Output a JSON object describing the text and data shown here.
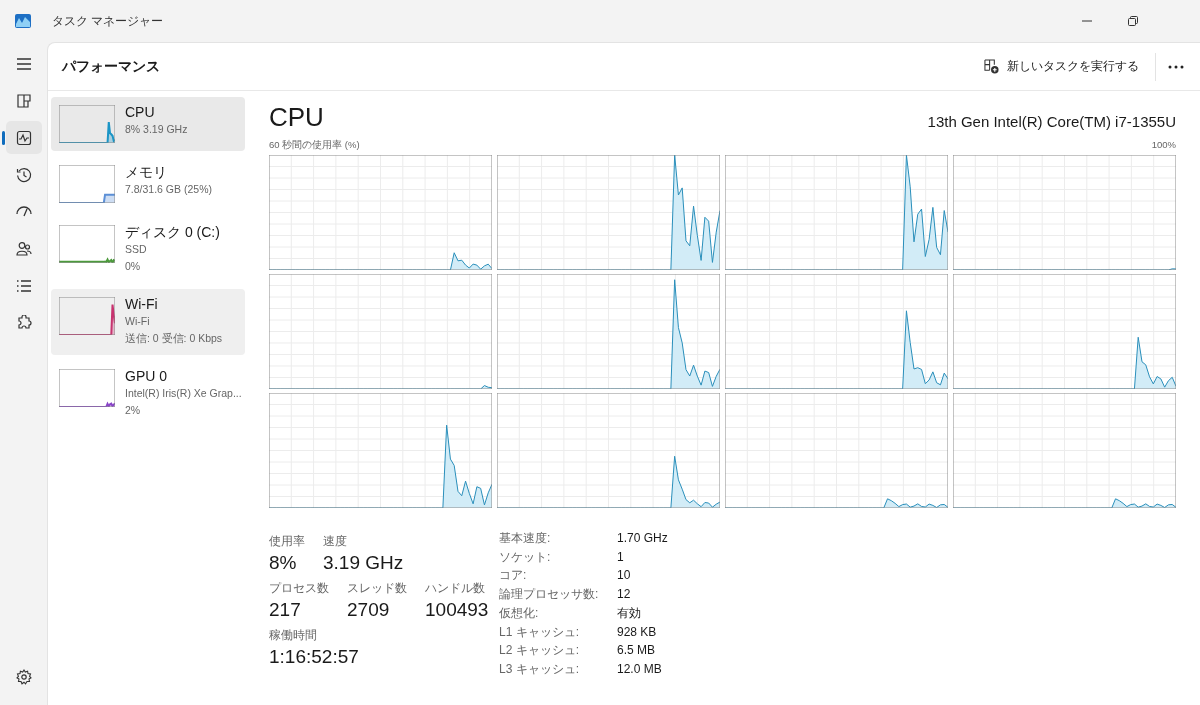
{
  "window": {
    "title": "タスク マネージャー"
  },
  "nav": [
    {
      "kind": "menu",
      "selected": false
    },
    {
      "kind": "processes",
      "selected": false
    },
    {
      "kind": "performance",
      "selected": true
    },
    {
      "kind": "history",
      "selected": false
    },
    {
      "kind": "startup",
      "selected": false
    },
    {
      "kind": "users",
      "selected": false
    },
    {
      "kind": "details",
      "selected": false
    },
    {
      "kind": "services",
      "selected": false
    }
  ],
  "nav_footer": {
    "kind": "settings",
    "selected": false
  },
  "page": {
    "title": "パフォーマンス",
    "run_task": "新しいタスクを実行する"
  },
  "devices": [
    {
      "kind": "cpu",
      "name": "CPU",
      "details": [
        "8%  3.19 GHz"
      ],
      "color": "#1b95c6",
      "selected": true,
      "hovered": false
    },
    {
      "kind": "memory",
      "name": "メモリ",
      "details": [
        "7.8/31.6 GB (25%)"
      ],
      "color": "#5b8fd6",
      "selected": false,
      "hovered": false
    },
    {
      "kind": "disk",
      "name": "ディスク 0 (C:)",
      "details": [
        "SSD",
        "0%"
      ],
      "color": "#4c9a3c",
      "selected": false,
      "hovered": false
    },
    {
      "kind": "network",
      "name": "Wi-Fi",
      "details": [
        "Wi-Fi",
        "送信: 0 受信: 0 Kbps"
      ],
      "color": "#c8336f",
      "selected": false,
      "hovered": true
    },
    {
      "kind": "gpu",
      "name": "GPU 0",
      "details": [
        "Intel(R) Iris(R) Xe Grap...",
        "2%"
      ],
      "color": "#8a45c8",
      "selected": false,
      "hovered": false
    }
  ],
  "detail": {
    "title": "CPU",
    "model": "13th Gen Intel(R) Core(TM) i7-1355U",
    "graph_label": "60 秒間の使用率 (%)",
    "graph_max": "100%"
  },
  "stat_rows": [
    [
      {
        "label": "使用率",
        "value": "8%"
      },
      {
        "label": "速度",
        "value": "3.19 GHz"
      }
    ],
    [
      {
        "label": "プロセス数",
        "value": "217"
      },
      {
        "label": "スレッド数",
        "value": "2709"
      },
      {
        "label": "ハンドル数",
        "value": "100493"
      }
    ],
    [
      {
        "label": "稼働時間",
        "value": "1:16:52:57"
      }
    ]
  ],
  "specs": [
    {
      "label": "基本速度:",
      "value": "1.70 GHz"
    },
    {
      "label": "ソケット:",
      "value": "1"
    },
    {
      "label": "コア:",
      "value": "10"
    },
    {
      "label": "論理プロセッサ数:",
      "value": "12"
    },
    {
      "label": "仮想化:",
      "value": "有効"
    },
    {
      "label": "L1 キャッシュ:",
      "value": "928 KB"
    },
    {
      "label": "L2 キャッシュ:",
      "value": "6.5 MB"
    },
    {
      "label": "L3 キャッシュ:",
      "value": "12.0 MB"
    }
  ]
}
